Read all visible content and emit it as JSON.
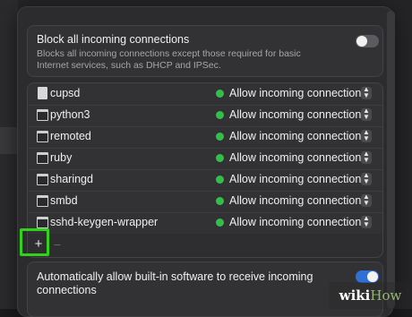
{
  "block_all": {
    "title": "Block all incoming connections",
    "description": "Blocks all incoming connections except those required for basic Internet services, such as DHCP and IPSec.",
    "enabled": false
  },
  "apps": [
    {
      "name": "cupsd",
      "icon": "document-icon",
      "status": "Allow incoming connections"
    },
    {
      "name": "python3",
      "icon": "terminal-app-icon",
      "status": "Allow incoming connections"
    },
    {
      "name": "remoted",
      "icon": "terminal-app-icon",
      "status": "Allow incoming connections"
    },
    {
      "name": "ruby",
      "icon": "terminal-app-icon",
      "status": "Allow incoming connections"
    },
    {
      "name": "sharingd",
      "icon": "terminal-app-icon",
      "status": "Allow incoming connections"
    },
    {
      "name": "smbd",
      "icon": "terminal-app-icon",
      "status": "Allow incoming connections"
    },
    {
      "name": "sshd-keygen-wrapper",
      "icon": "terminal-app-icon",
      "status": "Allow incoming connections"
    }
  ],
  "list_footer": {
    "add_label": "+",
    "remove_label": "−"
  },
  "auto_allow_builtin": {
    "label": "Automatically allow built-in software to receive incoming connections",
    "enabled": true
  },
  "colors": {
    "status_allow": "#2fbf4a",
    "toggle_on": "#2f6fd6",
    "highlight": "#32d11a"
  },
  "watermark": {
    "wiki": "wiki",
    "how": "How"
  }
}
